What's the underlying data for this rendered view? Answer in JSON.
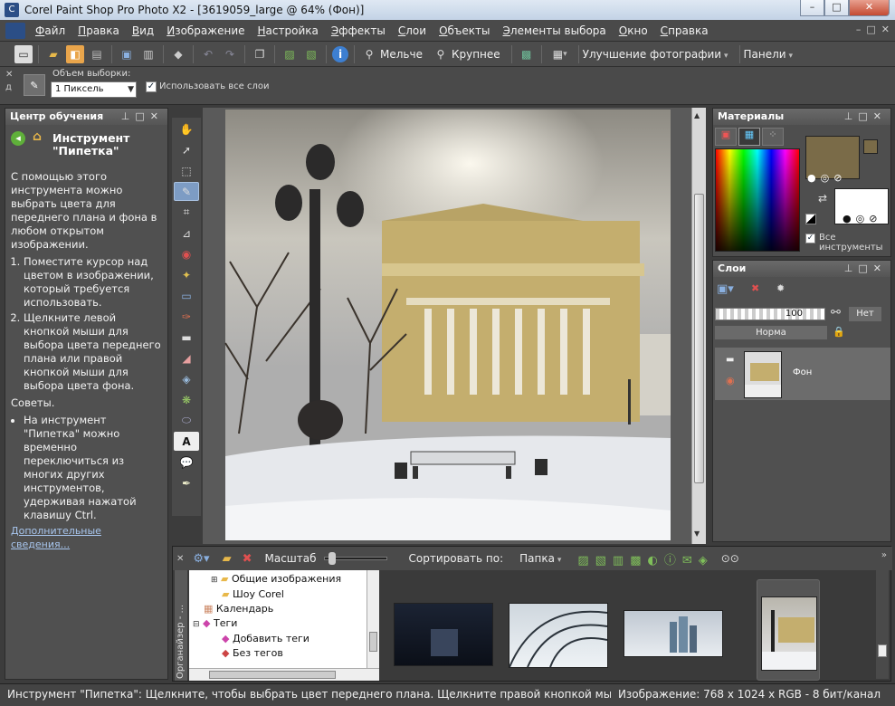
{
  "titlebar": {
    "title": "Corel Paint Shop Pro Photo X2 - [3619059_large @  64% (Фон)]",
    "min": "–",
    "max": "□",
    "close": "✕"
  },
  "menubar": {
    "items": [
      "Файл",
      "Правка",
      "Вид",
      "Изображение",
      "Настройка",
      "Эффекты",
      "Слои",
      "Объекты",
      "Элементы выбора",
      "Окно",
      "Справка"
    ],
    "right_controls": [
      "–",
      "□",
      "✕"
    ]
  },
  "toolbar": {
    "smaller_label": "Мельче",
    "larger_label": "Крупнее",
    "enhance_label": "Улучшение фотографии",
    "panels_label": "Панели"
  },
  "options": {
    "sample_size_label": "Объем выборки:",
    "sample_size_value": "1 Пиксель",
    "use_all_layers_label": "Использовать все слои",
    "use_all_layers_checked": true
  },
  "learning": {
    "header": "Центр обучения",
    "title": "Инструмент \"Пипетка\"",
    "intro": "С помощью этого инструмента можно выбрать цвета для переднего плана и фона в любом открытом изображении.",
    "steps": [
      "Поместите курсор над цветом в изображении, который требуется использовать.",
      "Щелкните левой кнопкой мыши для выбора цвета переднего плана или правой кнопкой мыши для выбора цвета фона."
    ],
    "tips_label": "Советы.",
    "tips": [
      "На инструмент \"Пипетка\" можно временно переключиться из многих других инструментов, удерживая нажатой клавишу Ctrl."
    ],
    "more_link": "Дополнительные сведения..."
  },
  "materials": {
    "header": "Материалы",
    "all_tools_label": "Все инструменты",
    "all_tools_checked": true,
    "foreground_color": "#7a6b48",
    "background_color": "#ffffff"
  },
  "layers": {
    "header": "Слои",
    "opacity": "100",
    "blend_mode": "Норма",
    "none_label": "Нет",
    "layer_name": "Фон"
  },
  "organizer": {
    "side_label": "Органайзер - ...",
    "zoom_label": "Масштаб",
    "sort_label": "Сортировать по:",
    "sort_value": "Папка",
    "tree": [
      {
        "label": "Общие изображения",
        "icon": "folder-icon",
        "indent": 1
      },
      {
        "label": "Шоу Corel",
        "icon": "folder-icon",
        "indent": 1
      },
      {
        "label": "Календарь",
        "icon": "calendar-icon",
        "indent": 0
      },
      {
        "label": "Теги",
        "icon": "tag-icon",
        "indent": 0
      },
      {
        "label": "Добавить теги",
        "icon": "tag-icon",
        "indent": 1
      },
      {
        "label": "Без тегов",
        "icon": "tag-icon",
        "indent": 1
      }
    ]
  },
  "status": {
    "left": "Инструмент \"Пипетка\": Щелкните, чтобы выбрать цвет переднего плана. Щелкните правой кнопкой мыши, чтобы выбрать",
    "right": "Изображение:  768 x 1024 x RGB - 8 бит/канал"
  },
  "colors": {
    "selected_tool": "#7d9cc4",
    "link": "#a8c6ee",
    "panel_bg": "#505050"
  }
}
